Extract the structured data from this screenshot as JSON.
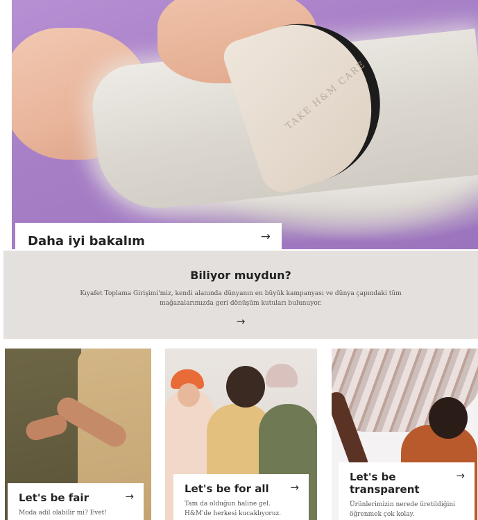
{
  "hero": {
    "comb_text": "TAKE H&M CARE",
    "card_title": "Daha iyi bakalım",
    "arrow": "→"
  },
  "info": {
    "heading": "Biliyor muydun?",
    "body": "Kıyafet Toplama Girişimi'miz, kendi alanında dünyanın en büyük kampanyası ve dünya çapındaki tüm mağazalarımızda geri dönüşüm kutuları bulunuyor.",
    "arrow": "→"
  },
  "cards": [
    {
      "title": "Let's be fair",
      "description": "Moda adil olabilir mi? Evet!",
      "arrow": "→"
    },
    {
      "title": "Let's be for all",
      "description": "Tam da olduğun haline gel. H&M'de herkesi kucaklıyoruz.",
      "arrow": "→"
    },
    {
      "title": "Let's be transparent",
      "description": "Ürünlerimizin nerede üretildiğini öğrenmek çok kolay.",
      "arrow": "→"
    }
  ]
}
